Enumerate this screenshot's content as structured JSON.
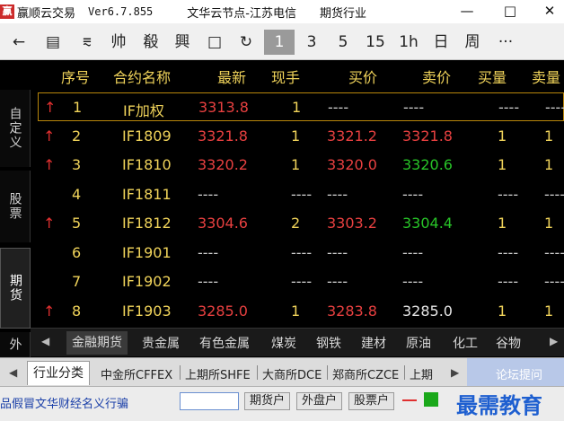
{
  "titlebar": {
    "icon": "赢",
    "app_name": "赢顺云交易",
    "version": "Ver6.7.855",
    "node": "文华云节点-江苏电信",
    "industry": "期货行业",
    "minimize": "—",
    "maximize": "□",
    "close": "✕"
  },
  "toolbar": {
    "back": "←",
    "report": "▤",
    "chart": "⩳",
    "item4": "帅",
    "item5": "殽",
    "item6": "興",
    "item7": "□",
    "refresh": "↻",
    "period_1": "1",
    "period_3": "3",
    "period_5": "5",
    "period_15": "15",
    "period_1h": "1h",
    "period_day": "日",
    "period_week": "周",
    "more": "···"
  },
  "left_tabs": [
    "自定义",
    "股票",
    "期货",
    "外"
  ],
  "columns": {
    "no": "序号",
    "name": "合约名称",
    "last": "最新",
    "vol": "现手",
    "bid": "买价",
    "ask": "卖价",
    "bidvol": "买量",
    "askvol": "卖量"
  },
  "rows": [
    {
      "arrow": "↑",
      "no": "1",
      "name": "IF加权",
      "last": "3313.8",
      "vol": "1",
      "bid": "----",
      "ask": "----",
      "bidvol": "----",
      "askvol": "----"
    },
    {
      "arrow": "↑",
      "no": "2",
      "name": "IF1809",
      "last": "3321.8",
      "vol": "1",
      "bid": "3321.2",
      "ask": "3321.8",
      "bidvol": "1",
      "askvol": "1"
    },
    {
      "arrow": "↑",
      "no": "3",
      "name": "IF1810",
      "last": "3320.2",
      "vol": "1",
      "bid": "3320.0",
      "ask": "3320.6",
      "bidvol": "1",
      "askvol": "1"
    },
    {
      "arrow": "",
      "no": "4",
      "name": "IF1811",
      "last": "----",
      "vol": "----",
      "bid": "----",
      "ask": "----",
      "bidvol": "----",
      "askvol": "----"
    },
    {
      "arrow": "↑",
      "no": "5",
      "name": "IF1812",
      "last": "3304.6",
      "vol": "2",
      "bid": "3303.2",
      "ask": "3304.4",
      "bidvol": "1",
      "askvol": "1"
    },
    {
      "arrow": "",
      "no": "6",
      "name": "IF1901",
      "last": "----",
      "vol": "----",
      "bid": "----",
      "ask": "----",
      "bidvol": "----",
      "askvol": "----"
    },
    {
      "arrow": "",
      "no": "7",
      "name": "IF1902",
      "last": "----",
      "vol": "----",
      "bid": "----",
      "ask": "----",
      "bidvol": "----",
      "askvol": "----"
    },
    {
      "arrow": "↑",
      "no": "8",
      "name": "IF1903",
      "last": "3285.0",
      "vol": "1",
      "bid": "3283.8",
      "ask": "3285.0",
      "bidvol": "1",
      "askvol": "1"
    }
  ],
  "categories": {
    "left_arrow": "◀",
    "right_arrow": "▶",
    "items": [
      "金融期货",
      "贵金属",
      "有色金属",
      "煤炭",
      "钢铁",
      "建材",
      "原油",
      "化工",
      "谷物"
    ]
  },
  "exchanges": {
    "left_arrow": "◀",
    "right_arrow": "▶",
    "items": [
      "行业分类",
      "中金所CFFEX",
      "上期所SHFE",
      "大商所DCE",
      "郑商所CZCE",
      "上期"
    ],
    "forum": "论坛提问"
  },
  "status": {
    "ticker": "品假冒文华财经名义行骗",
    "btn_futures": "期货户",
    "btn_overseas": "外盘户",
    "btn_stock": "股票户",
    "watermark": "最需教育"
  },
  "colors": {
    "up": "#e03030",
    "down": "#28c428",
    "neutral": "#f0d35a",
    "white": "#e6e6e6"
  }
}
